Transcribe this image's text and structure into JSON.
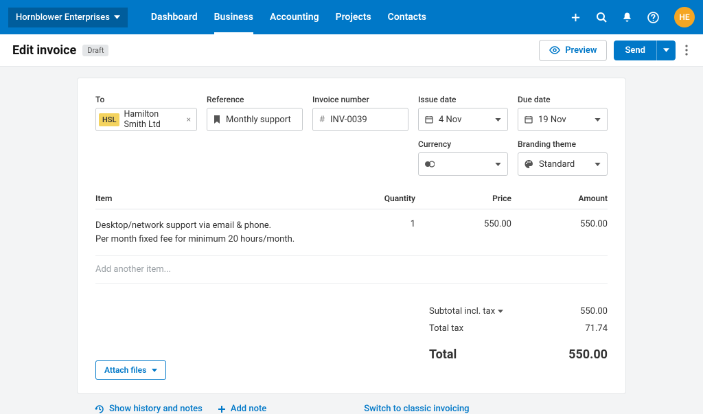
{
  "topbar": {
    "org_name": "Hornblower Enterprises",
    "nav": [
      "Dashboard",
      "Business",
      "Accounting",
      "Projects",
      "Contacts"
    ],
    "avatar_initials": "HE"
  },
  "subheader": {
    "title": "Edit invoice",
    "status": "Draft",
    "preview": "Preview",
    "send": "Send"
  },
  "fields": {
    "to_label": "To",
    "to_chip": "HSL",
    "to_value": "Hamilton Smith Ltd",
    "ref_label": "Reference",
    "ref_value": "Monthly support",
    "inv_label": "Invoice number",
    "inv_value": "INV-0039",
    "issue_label": "Issue date",
    "issue_value": "4 Nov",
    "due_label": "Due date",
    "due_value": "19 Nov",
    "cur_label": "Currency",
    "cur_value": "",
    "brand_label": "Branding theme",
    "brand_value": "Standard"
  },
  "table": {
    "headers": {
      "item": "Item",
      "qty": "Quantity",
      "price": "Price",
      "amount": "Amount"
    },
    "row": {
      "desc_l1": "Desktop/network support via email & phone.",
      "desc_l2": "Per month fixed fee for minimum 20 hours/month.",
      "qty": "1",
      "price": "550.00",
      "amount": "550.00"
    },
    "add_placeholder": "Add another item..."
  },
  "totals": {
    "subtotal_label": "Subtotal incl. tax",
    "subtotal_value": "550.00",
    "tax_label": "Total tax",
    "tax_value": "71.74",
    "total_label": "Total",
    "total_value": "550.00"
  },
  "attach": "Attach files",
  "footer": {
    "history": "Show history and notes",
    "addnote": "Add note",
    "classic": "Switch to classic invoicing"
  }
}
